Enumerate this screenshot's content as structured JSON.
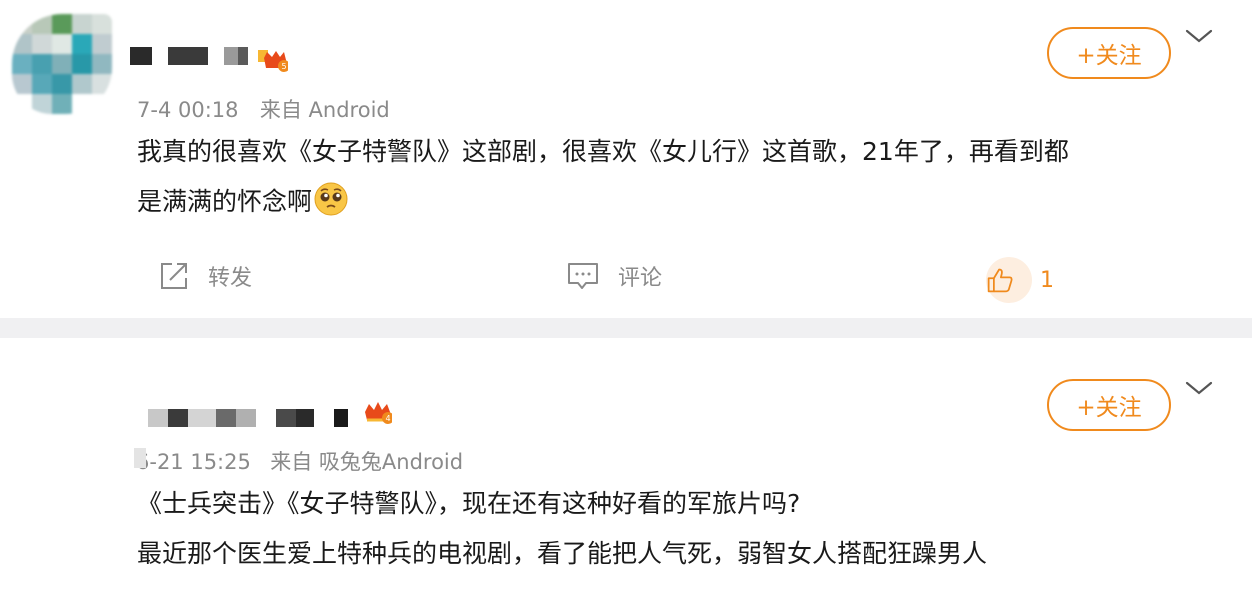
{
  "colors": {
    "accent": "#f08a1d",
    "meta_text": "#8a8a8a",
    "body_text": "#1a1a1a",
    "separator": "#f0f0f2"
  },
  "posts": [
    {
      "time": "7-4 00:18",
      "source": "来自 Android",
      "content_line1": "我真的很喜欢《女子特警队》这部剧，很喜欢《女儿行》这首歌，21年了，再看到都",
      "content_line2": "是满满的怀念啊",
      "content_emoji": "pleading-face-icon",
      "follow_label": "+关注",
      "actions": {
        "repost_label": "转发",
        "comment_label": "评论",
        "like_count": "1"
      },
      "avatar_colors": [
        "#c8d0c8",
        "#b8c8b8",
        "#5a9a5a",
        "#c8d4d0",
        "#d8e0dc",
        "#b0c4c8",
        "#d0d8d8",
        "#e0e8e4",
        "#2aa8b8",
        "#c0ccd0",
        "#6ab0c0",
        "#48a0b0",
        "#80b0b8",
        "#2898a8",
        "#90b8c0",
        "#b8c8d0",
        "#58a8b8",
        "#3898a8",
        "#b0c8cc",
        "#d8e0e0",
        "#ffffff",
        "#c0d4d8",
        "#70b0b8",
        "#ffffff",
        "#ffffff"
      ]
    },
    {
      "time": "6-21 15:25",
      "source": "来自 吸兔兔Android",
      "content_line1": "《士兵突击》《女子特警队》，现在还有这种好看的军旅片吗?",
      "content_line2": "最近那个医生爱上特种兵的电视剧，看了能把人气死，弱智女人搭配狂躁男人",
      "follow_label": "+关注",
      "avatar_colors": [
        "#ffffff",
        "#f8d8a0",
        "#e83030",
        "#f0a0a0",
        "#ffffff",
        "#f0c0a8",
        "#d82828",
        "#c81818",
        "#b84030",
        "#ffffff",
        "#e89090",
        "#c02020",
        "#d02020",
        "#a03020",
        "#ffffff",
        "#f8e070",
        "#6a3a2a",
        "#f0d0b0",
        "#e88080",
        "#f09090",
        "#ffffff",
        "#9a8a40",
        "#e07070",
        "#c81818",
        "#f0a080"
      ]
    }
  ]
}
